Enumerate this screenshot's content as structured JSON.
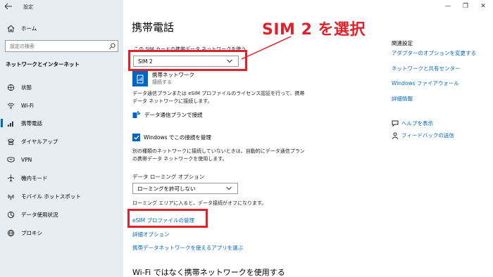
{
  "window": {
    "title": "設定",
    "controls": [
      "—",
      "❐",
      "✕"
    ]
  },
  "sidebar": {
    "home": "ホーム",
    "search_placeholder": "設定の検索",
    "section": "ネットワークとインターネット",
    "items": [
      {
        "label": "状態",
        "icon": "globe-status-icon"
      },
      {
        "label": "Wi-Fi",
        "icon": "wifi-icon"
      },
      {
        "label": "携帯電話",
        "icon": "cellular-icon"
      },
      {
        "label": "ダイヤルアップ",
        "icon": "dialup-icon"
      },
      {
        "label": "VPN",
        "icon": "vpn-icon"
      },
      {
        "label": "機内モード",
        "icon": "airplane-icon"
      },
      {
        "label": "モバイル ホットスポット",
        "icon": "hotspot-icon"
      },
      {
        "label": "データ使用状況",
        "icon": "data-usage-icon"
      },
      {
        "label": "プロキシ",
        "icon": "proxy-globe-icon"
      }
    ]
  },
  "main": {
    "title": "携帯電話",
    "sim_label": "この SIM カードの携帯データ ネットワークを使う",
    "sim_selected": "SIM 2",
    "connection_name": "携帯ネットワーク",
    "connection_status": "接続する",
    "data_plan_para": "データ通信プランまたは eSIM プロファイルのライセンス認証を行って、携帯データ ネットワークに接続します。",
    "data_plan_link": "データ通信プランで接続",
    "checkbox_label": "Windows でこの接続を管理",
    "other_network_para": "別の種類のネットワークに接続していないときは、自動的にデータ通信プランの携帯データ ネットワークを使用します。",
    "roaming_label": "データ ローミング オプション",
    "roaming_selected": "ローミングを許可しない",
    "roaming_para": "ローミング エリアに入ると、データ接続がオフになります。",
    "esim_link": "eSIM プロファイルの管理",
    "advanced_link": "詳細オプション",
    "apps_link": "携帯データネットワークを使えるアプリを選ぶ",
    "wifi_section": "Wi-Fi ではなく携帯ネットワークを使用する"
  },
  "annotation": {
    "text": "SIM 2 を選択",
    "color": "#e0202a"
  },
  "related": {
    "heading": "関連設定",
    "links": [
      "アダプターのオプションを変更する",
      "ネットワークと共有センター",
      "Windows ファイアウォール",
      "詳細情報"
    ],
    "help": "ヘルプを表示",
    "feedback": "フィードバックの送信"
  },
  "colors": {
    "accent": "#0067c0",
    "sidebar_bg": "#e6eef4",
    "highlight": "#e0202a"
  }
}
